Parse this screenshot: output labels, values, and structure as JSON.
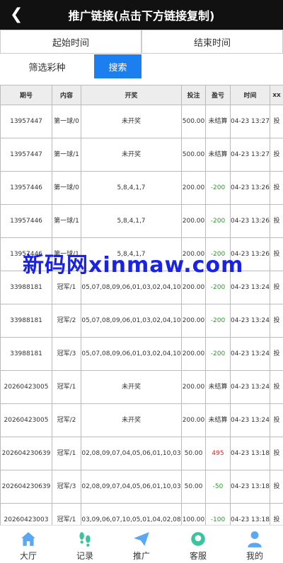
{
  "header": {
    "back_icon": "chevron-left-icon",
    "title": "推广链接(点击下方链接复制)"
  },
  "filters": {
    "start_time": "起始时间",
    "end_time": "结束时间",
    "lottery_label": "筛选彩种",
    "search_label": "搜索"
  },
  "table": {
    "headers": [
      "期号",
      "内容",
      "开奖",
      "投注",
      "盈亏",
      "时间",
      "xx"
    ],
    "rows": [
      {
        "issue": "13957447",
        "content": "第一球/0",
        "result": "未开奖",
        "bet": "500.00",
        "pl": "未结算",
        "time": "04-23 13:27",
        "op": "投"
      },
      {
        "issue": "13957447",
        "content": "第一球/1",
        "result": "未开奖",
        "bet": "500.00",
        "pl": "未结算",
        "time": "04-23 13:27",
        "op": "投"
      },
      {
        "issue": "13957446",
        "content": "第一球/0",
        "result": "5,8,4,1,7",
        "bet": "200.00",
        "pl": "-200",
        "time": "04-23 13:26",
        "op": "投"
      },
      {
        "issue": "13957446",
        "content": "第一球/1",
        "result": "5,8,4,1,7",
        "bet": "200.00",
        "pl": "-200",
        "time": "04-23 13:26",
        "op": "投"
      },
      {
        "issue": "13957446",
        "content": "第一球/1",
        "result": "5,8,4,1,7",
        "bet": "200.00",
        "pl": "-200",
        "time": "04-23 13:26",
        "op": "投"
      },
      {
        "issue": "33988181",
        "content": "冠军/1",
        "result": "05,07,08,09,06,01,03,02,04,10",
        "bet": "200.00",
        "pl": "-200",
        "time": "04-23 13:24",
        "op": "投"
      },
      {
        "issue": "33988181",
        "content": "冠军/2",
        "result": "05,07,08,09,06,01,03,02,04,10",
        "bet": "200.00",
        "pl": "-200",
        "time": "04-23 13:24",
        "op": "投"
      },
      {
        "issue": "33988181",
        "content": "冠军/3",
        "result": "05,07,08,09,06,01,03,02,04,10",
        "bet": "200.00",
        "pl": "-200",
        "time": "04-23 13:24",
        "op": "投"
      },
      {
        "issue": "20260423005",
        "content": "冠军/1",
        "result": "未开奖",
        "bet": "200.00",
        "pl": "未结算",
        "time": "04-23 13:24",
        "op": "投"
      },
      {
        "issue": "20260423005",
        "content": "冠军/2",
        "result": "未开奖",
        "bet": "200.00",
        "pl": "未结算",
        "time": "04-23 13:24",
        "op": "投"
      },
      {
        "issue": "202604230639",
        "content": "冠军/1",
        "result": "02,08,09,07,04,05,06,01,10,03",
        "bet": "50.00",
        "pl": "495",
        "time": "04-23 13:18",
        "op": "投"
      },
      {
        "issue": "202604230639",
        "content": "冠军/3",
        "result": "02,08,09,07,04,05,06,01,10,03",
        "bet": "50.00",
        "pl": "-50",
        "time": "04-23 13:18",
        "op": "投"
      },
      {
        "issue": "20260423003",
        "content": "冠军/1",
        "result": "03,09,06,07,10,05,01,04,02,08",
        "bet": "100.00",
        "pl": "-100",
        "time": "04-23 13:18",
        "op": "投"
      }
    ]
  },
  "watermark": "新码网xinmaw.com",
  "tabs": [
    {
      "label": "大厅",
      "icon": "home-icon"
    },
    {
      "label": "记录",
      "icon": "footprint-icon"
    },
    {
      "label": "推广",
      "icon": "paper-plane-icon"
    },
    {
      "label": "客服",
      "icon": "headset-icon"
    },
    {
      "label": "我的",
      "icon": "user-icon"
    }
  ],
  "colors": {
    "header_bg": "#111111",
    "accent": "#1c7ff0",
    "loss": "#2a9a2a",
    "win": "#e02020"
  }
}
